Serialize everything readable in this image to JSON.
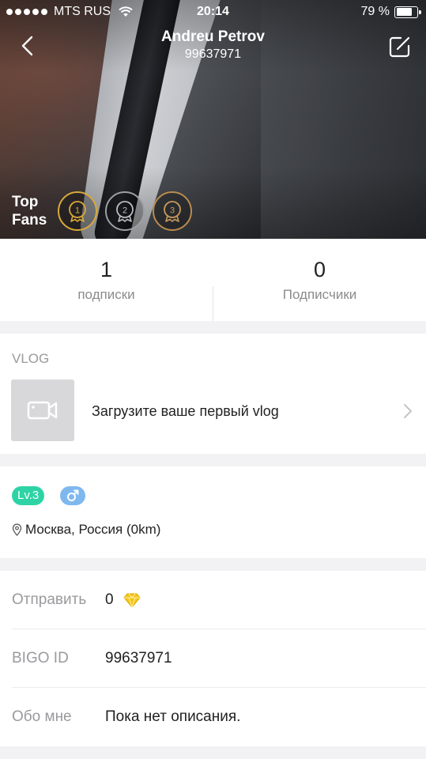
{
  "status_bar": {
    "carrier": "MTS RUS",
    "time": "20:14",
    "battery_text": "79 %",
    "battery_level": 0.79
  },
  "header": {
    "name": "Andreu Petrov",
    "user_id": "99637971"
  },
  "top_fans": {
    "label": "Top Fans",
    "badges": [
      "1",
      "2",
      "3"
    ]
  },
  "stats": {
    "following_count": "1",
    "following_label": "подписки",
    "followers_count": "0",
    "followers_label": "Подписчики"
  },
  "vlog": {
    "section_title": "VLOG",
    "prompt": "Загрузите ваше первый vlog"
  },
  "profile": {
    "level": "Lv.3",
    "location": "Москва, Россия (0km)"
  },
  "details": {
    "sent_label": "Отправить",
    "sent_value": "0",
    "bigo_id_label": "BIGO ID",
    "bigo_id_value": "99637971",
    "about_label": "Обо мне",
    "about_value": "Пока нет описания."
  },
  "colors": {
    "level_badge": "#2ed3a5",
    "gender_badge": "#7fb8ef",
    "gold_badge": "#d9a93a",
    "silver_badge": "#9aa0a6",
    "bronze_badge": "#b98b4e",
    "diamond": "#f5c518"
  },
  "icons": [
    "back-icon",
    "edit-icon",
    "wifi-icon",
    "battery-icon",
    "medal-icon",
    "video-camera-icon",
    "chevron-right-icon",
    "male-icon",
    "pin-icon",
    "diamond-icon"
  ]
}
